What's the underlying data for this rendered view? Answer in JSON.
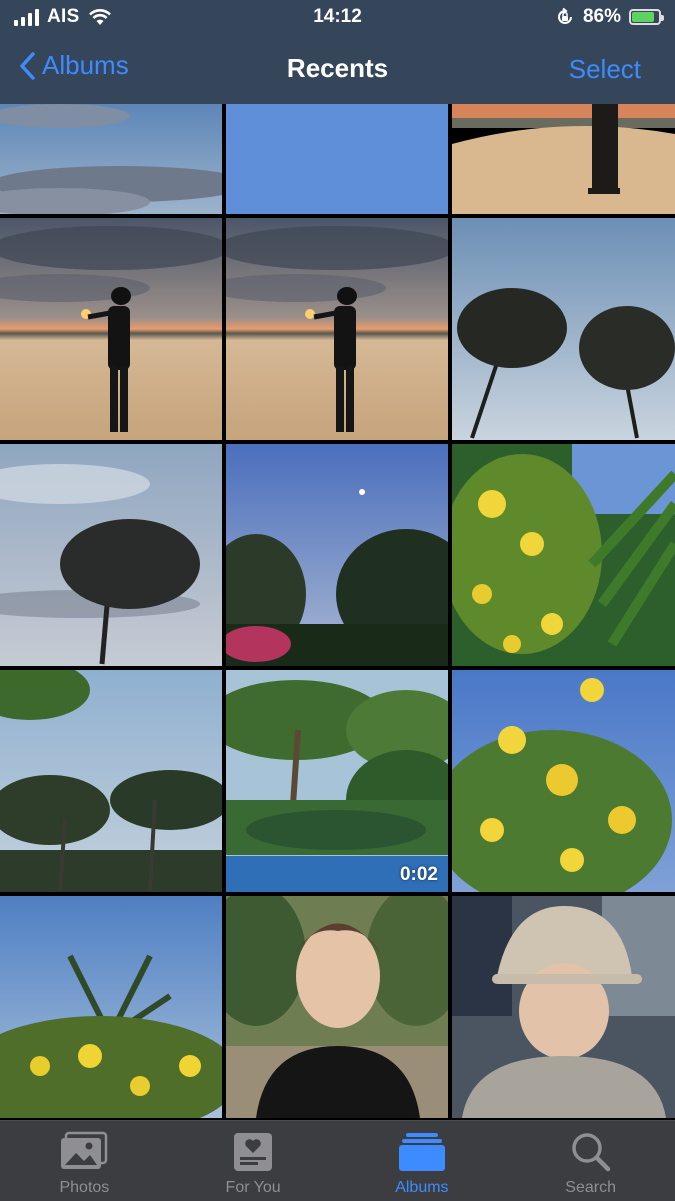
{
  "status_bar": {
    "carrier": "AIS",
    "time": "14:12",
    "battery_percent": "86%",
    "battery_level": 0.86,
    "icons": [
      "signal-icon",
      "wifi-icon",
      "rotation-lock-icon",
      "battery-charging-icon"
    ]
  },
  "nav": {
    "back_label": "Albums",
    "title": "Recents",
    "select_label": "Select"
  },
  "grid": {
    "columns": 3,
    "photos": [
      {
        "subject": "sky-clouds"
      },
      {
        "subject": "blue-sky"
      },
      {
        "subject": "desert-person-sunset"
      },
      {
        "subject": "desert-person-sun-hand"
      },
      {
        "subject": "desert-person-sun-hand"
      },
      {
        "subject": "trees-sky"
      },
      {
        "subject": "tree-cloudy-sky"
      },
      {
        "subject": "evening-sky-trees"
      },
      {
        "subject": "yellow-flowers-palm"
      },
      {
        "subject": "palm-trees"
      },
      {
        "subject": "palm-garden-pool-video",
        "duration": "0:02"
      },
      {
        "subject": "yellow-flowers-sky"
      },
      {
        "subject": "palm-yellow-flowers"
      },
      {
        "subject": "selfie-garden"
      },
      {
        "subject": "selfie-bucket-hat"
      }
    ]
  },
  "tabs": [
    {
      "label": "Photos",
      "icon": "photos-icon",
      "active": false
    },
    {
      "label": "For You",
      "icon": "for-you-icon",
      "active": false
    },
    {
      "label": "Albums",
      "icon": "albums-icon",
      "active": true
    },
    {
      "label": "Search",
      "icon": "search-icon",
      "active": false
    }
  ],
  "colors": {
    "accent": "#3d8bff",
    "bar_background": "#3a4c62",
    "tab_bar_background": "#3b3d40",
    "tab_inactive": "#8e8e93"
  }
}
